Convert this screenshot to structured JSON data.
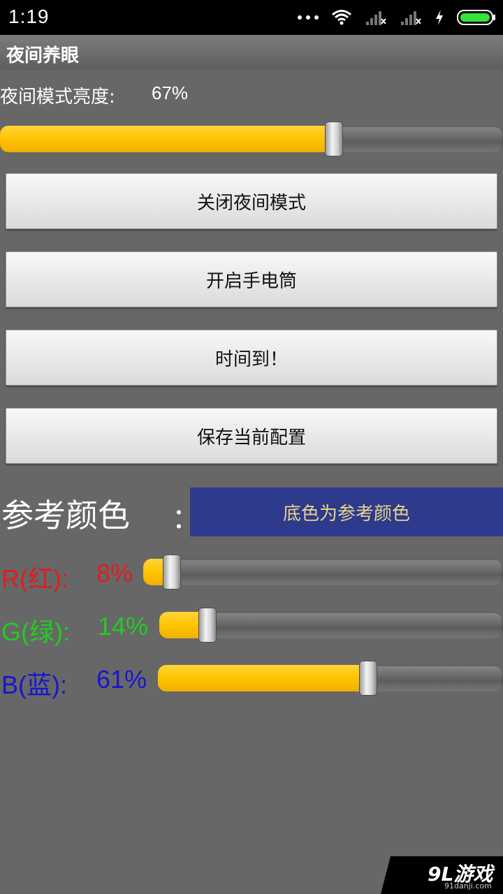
{
  "status_bar": {
    "time": "1:19",
    "icons": [
      "more-dots-icon",
      "wifi-icon",
      "signal-no-sim-icon",
      "signal-no-sim-icon",
      "charging-icon",
      "battery-icon"
    ]
  },
  "app": {
    "title": "夜间养眼"
  },
  "brightness": {
    "label": "夜间模式亮度:",
    "value_text": "67%",
    "value": 0.67
  },
  "buttons": {
    "close_night_mode": "关闭夜间模式",
    "open_flashlight": "开启手电筒",
    "time_up": "时间到！",
    "save_config": "保存当前配置"
  },
  "reference": {
    "label": "参考颜色",
    "colon": "：",
    "swatch_text": "底色为参考颜色",
    "swatch_color": "#2e3a8c",
    "swatch_text_color": "#e7d58a"
  },
  "rgb": {
    "r": {
      "label": "R(红):",
      "value_text": "8%",
      "value": 0.08,
      "color": "#e11d1d"
    },
    "g": {
      "label": "G(绿):",
      "value_text": "14%",
      "value": 0.14,
      "color": "#22cc22"
    },
    "b": {
      "label": "B(蓝):",
      "value_text": "61%",
      "value": 0.61,
      "color": "#1616d0"
    }
  },
  "watermark": {
    "logo": "9L游戏",
    "url": "91danji.com"
  }
}
